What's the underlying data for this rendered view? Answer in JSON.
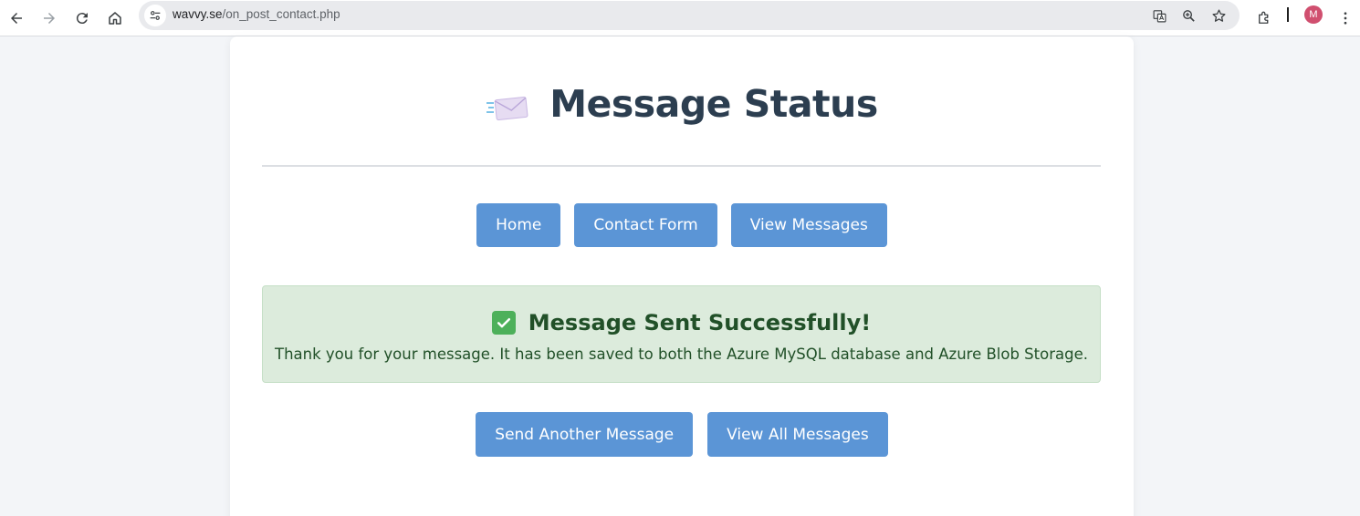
{
  "browser": {
    "url_domain": "wavvy.se",
    "url_path": "/on_post_contact.php",
    "profile_initial": "M",
    "icons": [
      "back-icon",
      "forward-icon",
      "reload-icon",
      "home-icon",
      "site-info-icon",
      "translate-icon",
      "zoom-icon",
      "bookmark-star-icon",
      "extensions-icon",
      "menu-kebab-icon"
    ]
  },
  "page": {
    "title": "Message Status",
    "nav": {
      "home": "Home",
      "contact_form": "Contact Form",
      "view_messages": "View Messages"
    },
    "alert": {
      "heading": "Message Sent Successfully!",
      "text": "Thank you for your message. It has been saved to both the Azure MySQL database and Azure Blob Storage."
    },
    "actions": {
      "send_another": "Send Another Message",
      "view_all": "View All Messages"
    }
  },
  "colors": {
    "button": "#5b95d6",
    "title": "#2c3e50",
    "success_bg": "#dcebdc",
    "success_text": "#215028"
  }
}
